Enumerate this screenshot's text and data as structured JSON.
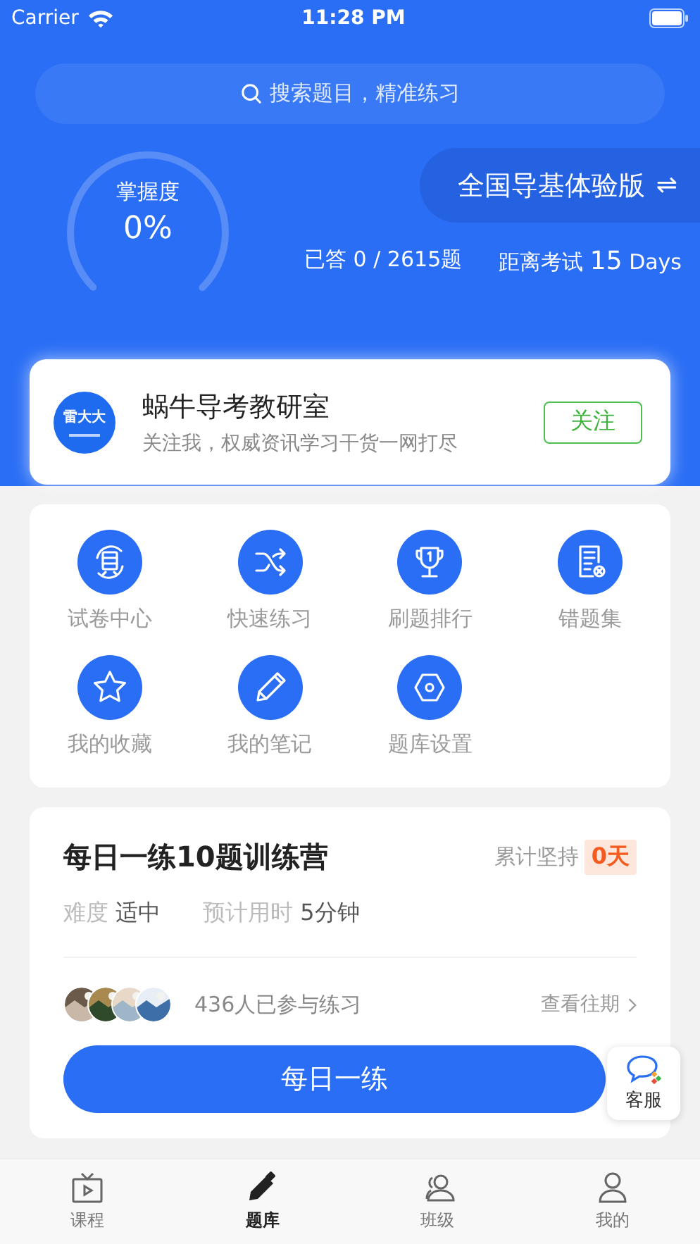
{
  "status_bar": {
    "carrier": "Carrier",
    "time": "11:28 PM"
  },
  "search": {
    "placeholder": "搜索题目，精准练习"
  },
  "mastery": {
    "label": "掌握度",
    "value": "0%"
  },
  "version": {
    "label": "全国导基体验版",
    "switch_glyph": "⇌"
  },
  "stats": {
    "answered": "已答 0 / 2615题",
    "exam_label": "距离考试",
    "exam_days": "15",
    "exam_unit": "Days"
  },
  "channel": {
    "logo_text": "雷大大",
    "name": "蜗牛导考教研室",
    "desc": "关注我，权威资讯学习干货一网打尽",
    "follow": "关注"
  },
  "features": [
    {
      "label": "试卷中心",
      "kind": "exam"
    },
    {
      "label": "快速练习",
      "kind": "shuffle"
    },
    {
      "label": "刷题排行",
      "kind": "trophy"
    },
    {
      "label": "错题集",
      "kind": "wrong"
    },
    {
      "label": "我的收藏",
      "kind": "star"
    },
    {
      "label": "我的笔记",
      "kind": "pencil"
    },
    {
      "label": "题库设置",
      "kind": "settings"
    }
  ],
  "daily": {
    "title": "每日一练10题训练营",
    "streak_label": "累计坚持",
    "streak_value": "0天",
    "difficulty_label": "难度",
    "difficulty": "适中",
    "time_label": "预计用时",
    "time": "5分钟",
    "participants": "436人已参与练习",
    "history": "查看往期",
    "button": "每日一练"
  },
  "service": {
    "label": "客服"
  },
  "tabs": [
    {
      "label": "课程",
      "kind": "course",
      "selected": false
    },
    {
      "label": "题库",
      "kind": "bank",
      "selected": true
    },
    {
      "label": "班级",
      "kind": "class",
      "selected": false
    },
    {
      "label": "我的",
      "kind": "me",
      "selected": false
    }
  ]
}
